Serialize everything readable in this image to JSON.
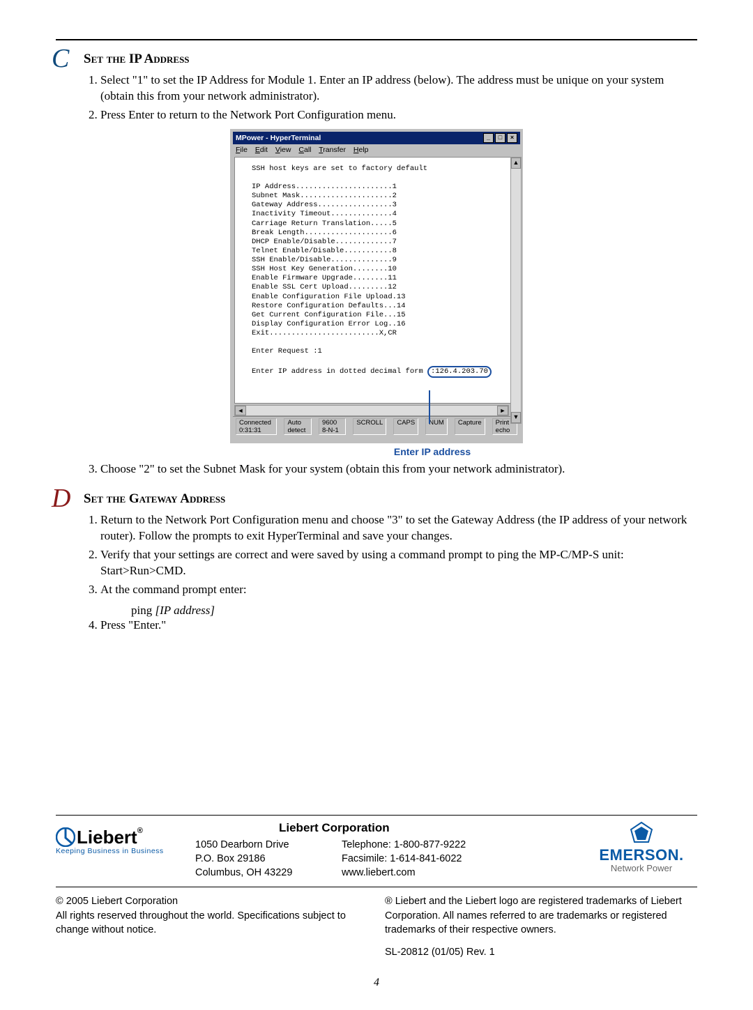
{
  "sectionC": {
    "letter": "C",
    "heading": "Set the IP Address",
    "steps": [
      "Select \"1\" to set the IP Address for Module 1. Enter an IP address (below). The address must be unique on your system (obtain this from your network administrator).",
      "Press Enter to return to the Network Port Configuration menu."
    ],
    "step3": "Choose \"2\" to set the Subnet Mask for your system (obtain this from your network administrator)."
  },
  "terminal": {
    "window_title": "MPower - HyperTerminal",
    "menu": [
      "File",
      "Edit",
      "View",
      "Call",
      "Transfer",
      "Help"
    ],
    "intro": "SSH host keys are set to factory default",
    "options": [
      "IP Address......................1",
      "Subnet Mask.....................2",
      "Gateway Address.................3",
      "Inactivity Timeout..............4",
      "Carriage Return Translation.....5",
      "Break Length....................6",
      "DHCP Enable/Disable.............7",
      "Telnet Enable/Disable...........8",
      "SSH Enable/Disable..............9",
      "SSH Host Key Generation........10",
      "Enable Firmware Upgrade........11",
      "Enable SSL Cert Upload.........12",
      "Enable Configuration File Upload.13",
      "Restore Configuration Defaults...14",
      "Get Current Configuration File...15",
      "Display Configuration Error Log..16",
      "Exit.........................X,CR"
    ],
    "enter_request": "Enter Request :1",
    "prompt_prefix": "Enter IP address in dotted decimal form ",
    "ip_value": ":126.4.203.70",
    "status": [
      "Connected 0:31:31",
      "Auto detect",
      "9600 8-N-1",
      "SCROLL",
      "CAPS",
      "NUM",
      "Capture",
      "Print echo"
    ],
    "callout": "Enter IP address"
  },
  "sectionD": {
    "letter": "D",
    "heading": "Set the Gateway Address",
    "step1": "Return to the Network Port Configuration menu and choose \"3\" to set the Gateway Address (the IP address of your network router). Follow the prompts to exit HyperTerminal and save your changes.",
    "step2": "Verify that your settings are correct and were saved by using a command prompt to ping the MP-C/MP-S unit: Start>Run>CMD.",
    "step3": "At the command prompt enter:",
    "step3_cmd_a": "ping ",
    "step3_cmd_b": "[IP address]",
    "step4": "Press \"Enter.\""
  },
  "footer": {
    "liebert_tag": "Keeping Business in Business",
    "corp_heading": "Liebert Corporation",
    "addr1": "1050 Dearborn Drive",
    "addr2": "P.O. Box 29186",
    "addr3": "Columbus, OH 43229",
    "tel": "Telephone: 1-800-877-9222",
    "fax": "Facsimile: 1-614-841-6022",
    "web": "www.liebert.com",
    "emerson_name": "EMERSON.",
    "emerson_sub": "Network Power",
    "legal_l1": "© 2005 Liebert Corporation",
    "legal_l2": "All rights reserved throughout the world. Specifications subject to change without notice.",
    "legal_r": "® Liebert and the Liebert logo are registered trademarks of Liebert Corporation. All names referred to are trademarks or registered trademarks of their respective owners.",
    "docnum": "SL-20812 (01/05) Rev. 1"
  },
  "page_number": "4"
}
